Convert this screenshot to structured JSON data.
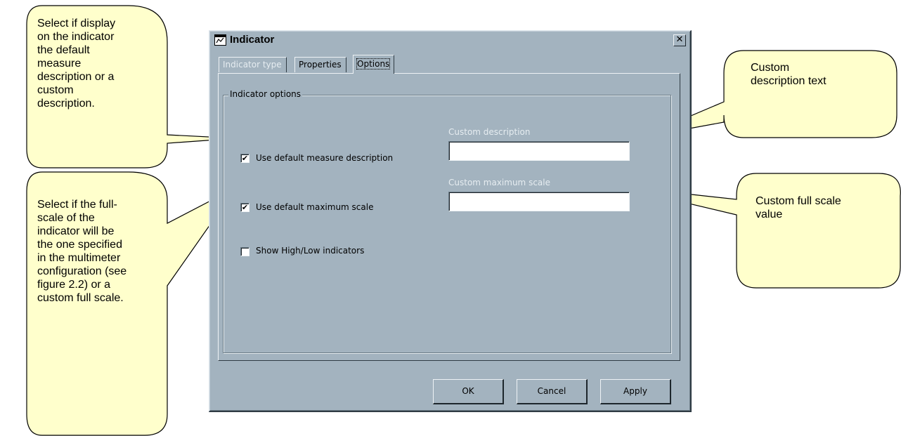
{
  "callouts": {
    "top_left": [
      "Select if display",
      "on the indicator",
      "the default",
      "measure",
      "description or a",
      "custom",
      "description."
    ],
    "bottom_left": [
      "Select if the full-",
      "scale of the",
      "indicator will be",
      "the one specified",
      "in  the multimeter",
      "configuration (see",
      "figure 2.2) or a",
      "custom full scale."
    ],
    "top_right": [
      "Custom",
      "description text"
    ],
    "bottom_right": [
      "Custom full scale",
      "value"
    ]
  },
  "colors": {
    "callout_fill": "#ffffcc",
    "dialog_face": "#a3b3bf"
  },
  "dialog": {
    "title": "Indicator",
    "title_icon": "window-icon",
    "close_icon": "close-icon",
    "close_glyph": "✕",
    "tabs": [
      {
        "label": "Indicator type",
        "state": "disabled"
      },
      {
        "label": "Properties",
        "state": "normal"
      },
      {
        "label": "Options",
        "state": "active"
      }
    ],
    "group_title": "Indicator options",
    "options": [
      {
        "label": "Use default measure description",
        "checked": true
      },
      {
        "label": "Use default maximum scale",
        "checked": true
      },
      {
        "label": "Show High/Low indicators",
        "checked": false
      }
    ],
    "custom_description": {
      "label": "Custom description",
      "value": ""
    },
    "custom_max_scale": {
      "label": "Custom maximum scale",
      "value": ""
    },
    "buttons": {
      "ok": "OK",
      "cancel": "Cancel",
      "apply": "Apply"
    }
  }
}
